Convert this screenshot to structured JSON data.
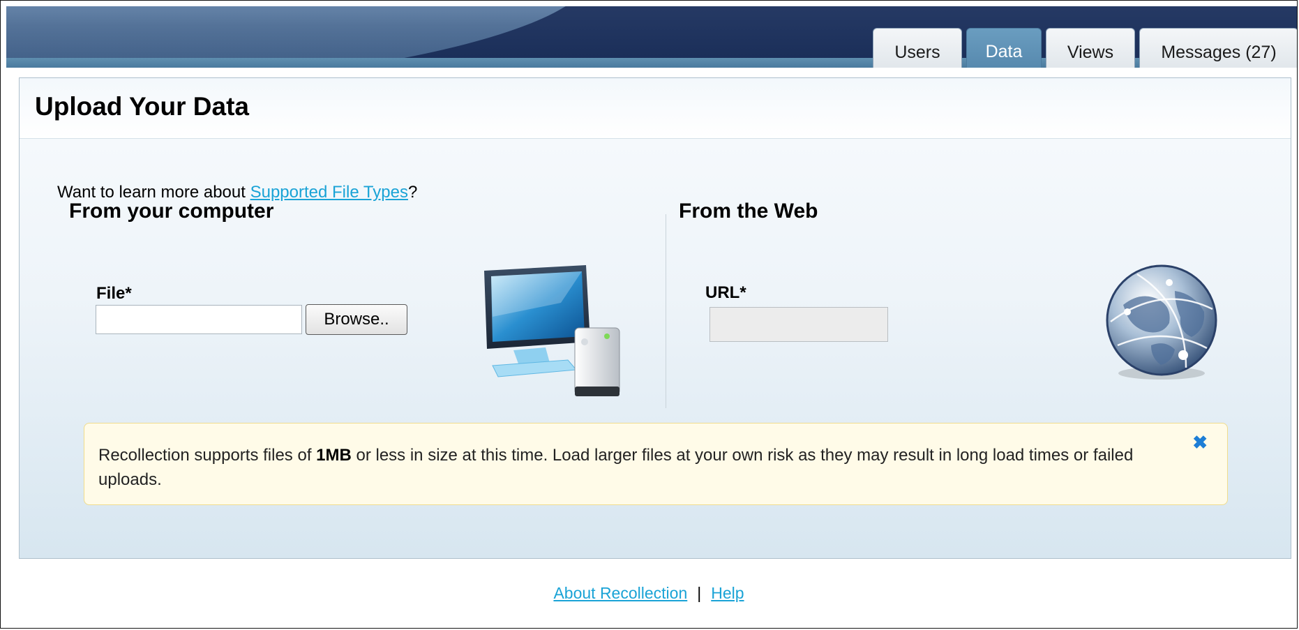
{
  "header": {
    "tabs": [
      {
        "label": "Users",
        "active": false
      },
      {
        "label": "Data",
        "active": true
      },
      {
        "label": "Views",
        "active": false
      },
      {
        "label": "Messages (27)",
        "active": false
      }
    ]
  },
  "page": {
    "title": "Upload Your Data",
    "learn_prefix": "Want to learn more about ",
    "learn_link": "Supported File Types",
    "learn_suffix": "?"
  },
  "computer_section": {
    "title": "From your computer",
    "file_label": "File*",
    "file_value": "",
    "browse_label": "Browse..",
    "icon": "computer-icon"
  },
  "web_section": {
    "title": "From the Web",
    "url_label": "URL*",
    "url_value": "",
    "icon": "globe-icon"
  },
  "notice": {
    "text_before": "Recollection supports files of ",
    "text_bold": "1MB",
    "text_after": " or less in size at this time. Load larger files at your own risk as they may result in long load times or failed uploads.",
    "close_glyph": "✖"
  },
  "footer": {
    "about_link": "About Recollection",
    "separator": "|",
    "help_link": "Help"
  },
  "colors": {
    "banner": "#1a2f5c",
    "active_tab": "#5f92b6",
    "link": "#1aa3d6",
    "notice_bg": "#fffbe8",
    "close": "#1d7ed6"
  }
}
